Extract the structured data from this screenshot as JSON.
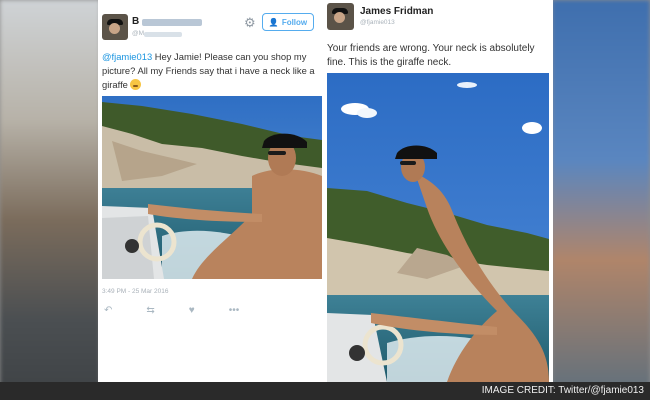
{
  "left_tweet": {
    "author_name": "B",
    "author_handle": "@M",
    "follow_label": "Follow",
    "mention": "@fjamie013",
    "text": " Hey Jamie! Please can you shop my picture? All my Friends say that i have a neck like a giraffe",
    "timestamp": "3:49 PM - 25 Mar 2016"
  },
  "right_tweet": {
    "author_name": "James Fridman",
    "author_handle": "@fjamie013",
    "text": "Your friends are wrong. Your neck is absolutely fine. This is the giraffe neck."
  },
  "credit": "IMAGE CREDIT: Twitter/@fjamie013",
  "colors": {
    "twitter_blue": "#55acee",
    "credit_bar": "#2a2a2a"
  }
}
